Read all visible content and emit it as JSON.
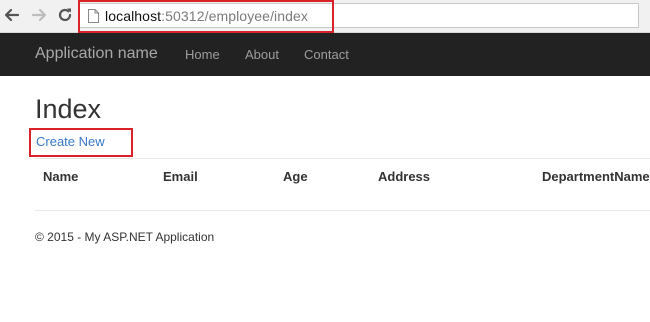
{
  "browser": {
    "url_host": "localhost",
    "url_rest": ":50312/employee/index",
    "icons": [
      "back-arrow-icon",
      "forward-arrow-icon",
      "reload-icon",
      "page-icon"
    ]
  },
  "navbar": {
    "brand": "Application name",
    "links": [
      "Home",
      "About",
      "Contact"
    ]
  },
  "page": {
    "title": "Index",
    "create_link": "Create New"
  },
  "table": {
    "headers": [
      "Name",
      "Email",
      "Age",
      "Address",
      "DepartmentName"
    ],
    "rows": []
  },
  "footer": {
    "text": "© 2015 - My ASP.NET Application"
  },
  "colors": {
    "navbar_bg": "#222222",
    "link": "#3a7ac8",
    "highlight": "#d9222a"
  }
}
